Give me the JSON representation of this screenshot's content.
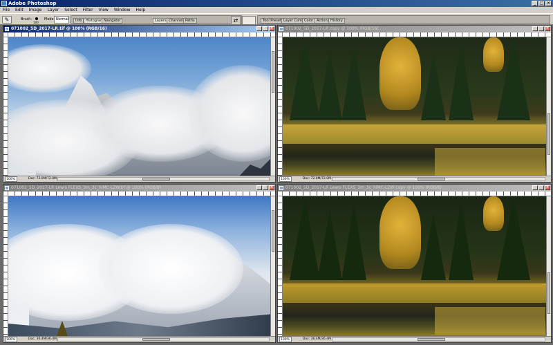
{
  "app": {
    "title": "Adobe Photoshop",
    "window_buttons": [
      "_",
      "□",
      "×"
    ]
  },
  "menu": [
    "File",
    "Edit",
    "Image",
    "Layer",
    "Select",
    "Filter",
    "View",
    "Window",
    "Help"
  ],
  "options": {
    "brush_label": "Brush:",
    "brush_size": "100",
    "mode_label": "Mode:",
    "mode_value": "Normal",
    "left_tabs": [
      "Info",
      "Histogram",
      "Navigator"
    ],
    "mid_tabs": [
      "Layers",
      "Channels",
      "Paths"
    ],
    "right_tabs": [
      "Tool Presets",
      "Layer Comps",
      "Color",
      "Actions",
      "History"
    ]
  },
  "documents": [
    {
      "title": "071002_5D_2017-LR.tif @ 100% (RGB/16)",
      "zoom": "100%",
      "doc_size": "Doc: 72.0M/72.0M",
      "active": true,
      "scene": "mountain"
    },
    {
      "title": "071002_5D_2017-LR copy @ 100% (RGB/16)",
      "zoom": "100%",
      "doc_size": "Doc: 72.0M/72.0M",
      "active": false,
      "scene": "forest"
    },
    {
      "title": "071002_5D_2017-LR Lewis FLEXS_3m_3c_hiMC-LZW.tif @ 100% (RGB/8)",
      "zoom": "100%",
      "doc_size": "Doc: 36.4M/36.4M",
      "active": false,
      "scene": "mountain"
    },
    {
      "title": "071002_5D_2017-LR Lewis FLEXS_3m_3c_hiMC-LZW copy @ 100% (RGB/8)",
      "zoom": "100%",
      "doc_size": "Doc: 36.4M/36.4M",
      "active": false,
      "scene": "forest"
    }
  ],
  "icons": {
    "tool_preset": "brush-icon",
    "palette_toggle": "swap-icon",
    "doc": "photoshop-doc-icon"
  }
}
